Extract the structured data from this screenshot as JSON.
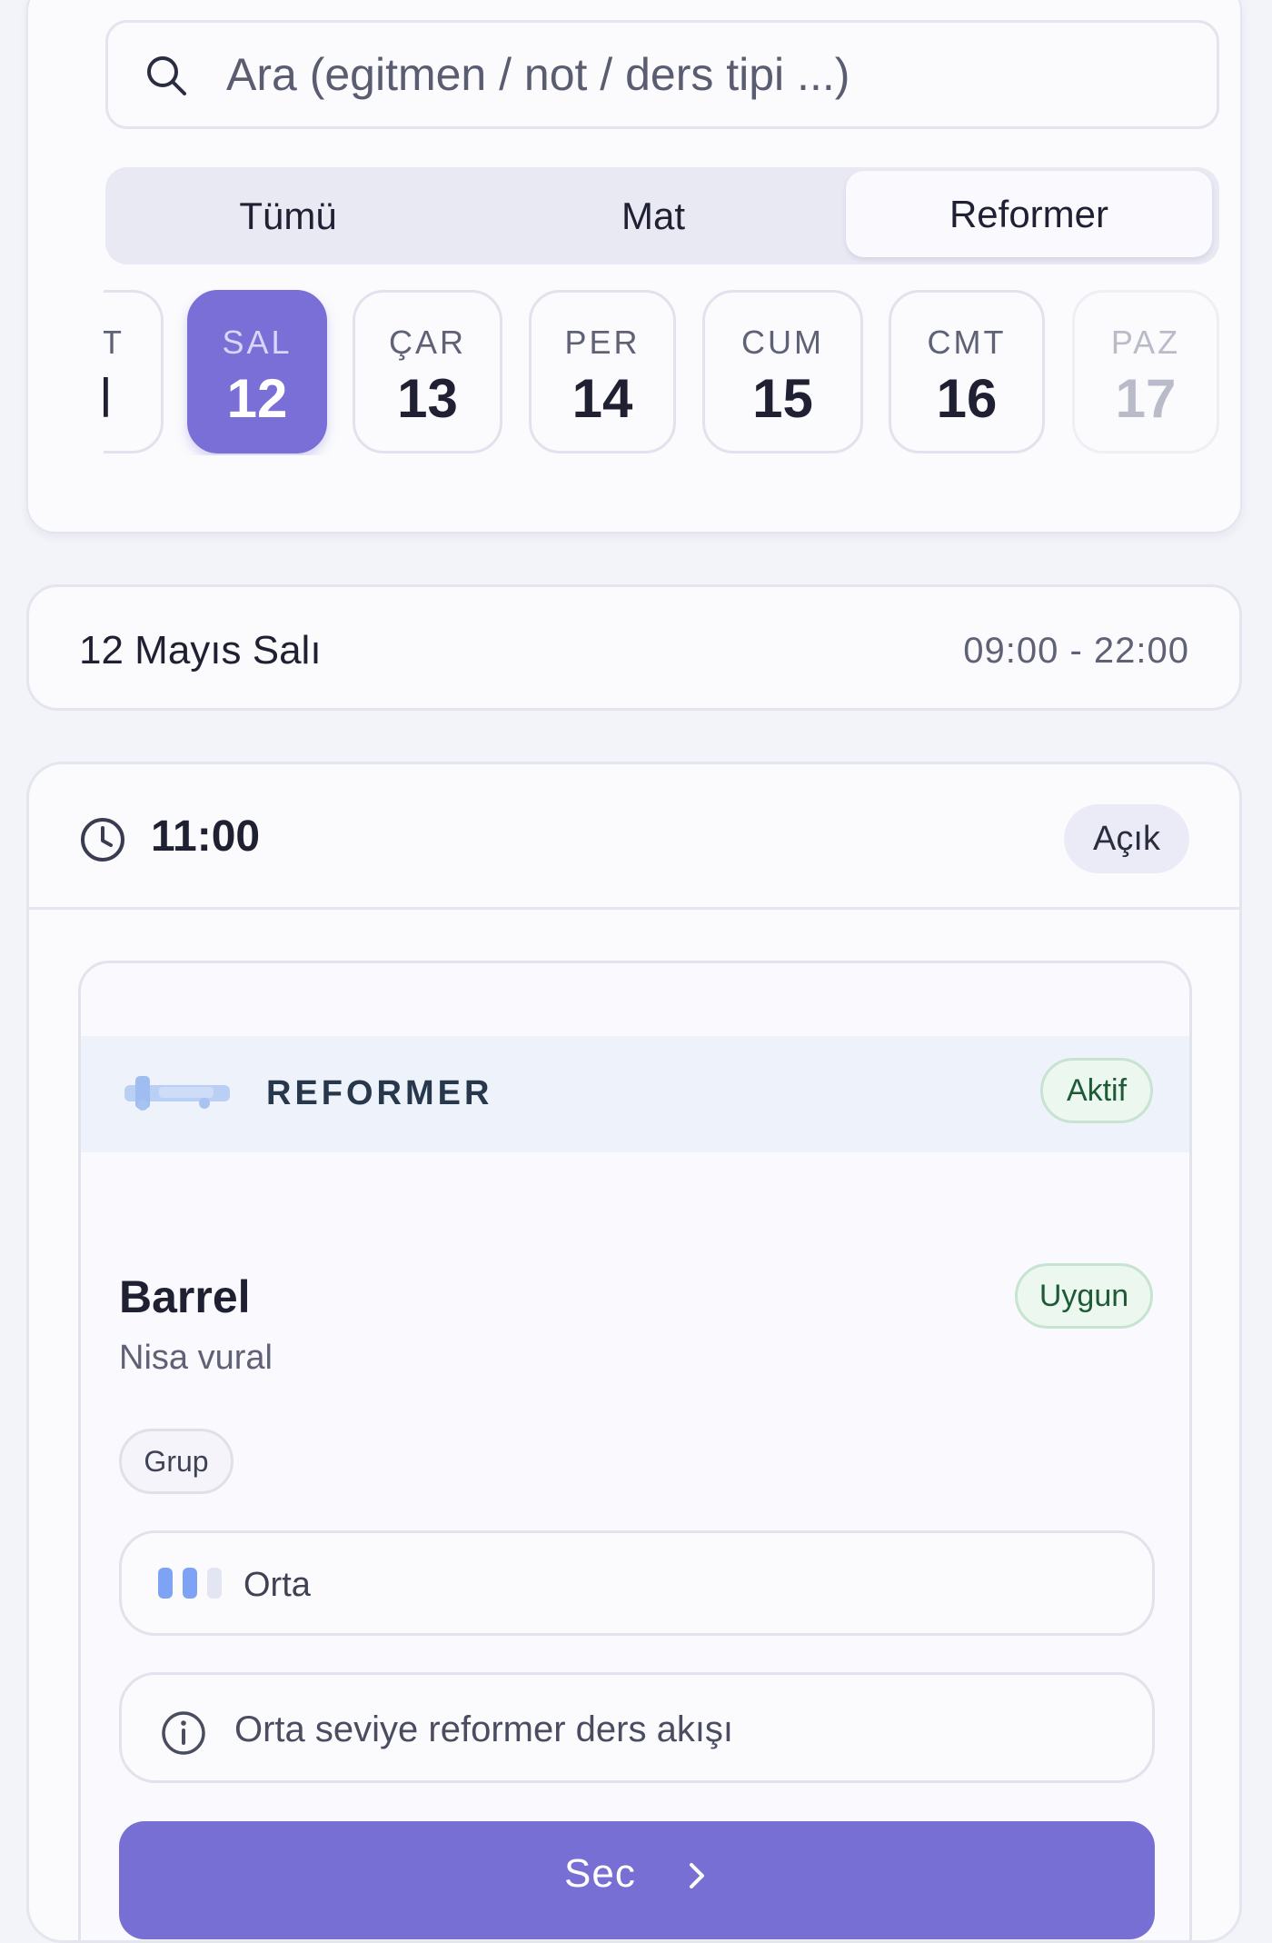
{
  "search": {
    "placeholder": "Ara (egitmen / not / ders tipi ...)",
    "icon": "search-icon"
  },
  "filters": {
    "tabs": [
      {
        "label": "Tümü",
        "selected": false
      },
      {
        "label": "Mat",
        "selected": false
      },
      {
        "label": "Reformer",
        "selected": true
      }
    ]
  },
  "days": [
    {
      "name": "T",
      "date": "l",
      "state": "partial"
    },
    {
      "name": "SAL",
      "date": "12",
      "state": "selected"
    },
    {
      "name": "ÇAR",
      "date": "13",
      "state": "normal"
    },
    {
      "name": "PER",
      "date": "14",
      "state": "normal"
    },
    {
      "name": "CUM",
      "date": "15",
      "state": "normal"
    },
    {
      "name": "CMT",
      "date": "16",
      "state": "normal"
    },
    {
      "name": "PAZ",
      "date": "17",
      "state": "disabled"
    }
  ],
  "date_bar": {
    "date": "12 Mayıs Salı",
    "hours": "09:00 - 22:00"
  },
  "slot": {
    "time": "11:00",
    "status": "Açık",
    "icon": "clock-icon"
  },
  "class": {
    "type_label": "REFORMER",
    "type_status": "Aktif",
    "name": "Barrel",
    "availability": "Uygun",
    "instructor": "Nisa vural",
    "format": "Grup",
    "level": "Orta",
    "level_filled": 2,
    "level_total": 3,
    "note": "Orta seviye reformer ders akışı",
    "select_label": "Sec"
  },
  "colors": {
    "accent": "#786fd5",
    "level_bar": "#7fa3f4",
    "level_bar_empty": "#e3e5f2",
    "badge_green_bg": "#ecf7ef",
    "badge_green_text": "#1d5a36"
  }
}
